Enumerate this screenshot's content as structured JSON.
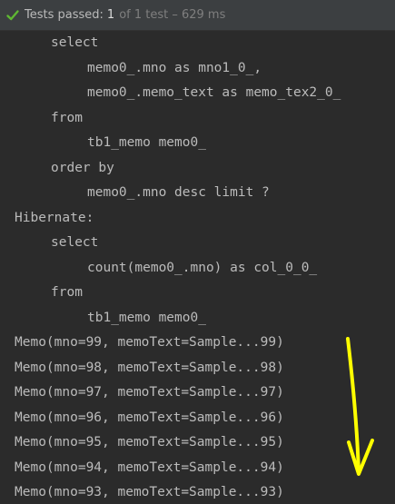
{
  "status": {
    "icon": "check-icon",
    "icon_color": "#5fb832",
    "label": "Tests passed:",
    "count": "1",
    "detail": "of 1 test – 629 ms"
  },
  "console": {
    "lines": [
      "select",
      "memo0_.mno as mno1_0_,",
      "memo0_.memo_text as memo_tex2_0_",
      "from",
      "tb1_memo memo0_",
      "order by",
      "memo0_.mno desc limit ?",
      "Hibernate:",
      "select",
      "count(memo0_.mno) as col_0_0_",
      "from",
      "tb1_memo memo0_",
      "Memo(mno=99, memoText=Sample...99)",
      "Memo(mno=98, memoText=Sample...98)",
      "Memo(mno=97, memoText=Sample...97)",
      "Memo(mno=96, memoText=Sample...96)",
      "Memo(mno=95, memoText=Sample...95)",
      "Memo(mno=94, memoText=Sample...94)",
      "Memo(mno=93, memoText=Sample...93)"
    ]
  },
  "annotation": {
    "color": "#ffff00",
    "shape": "down-arrow"
  }
}
